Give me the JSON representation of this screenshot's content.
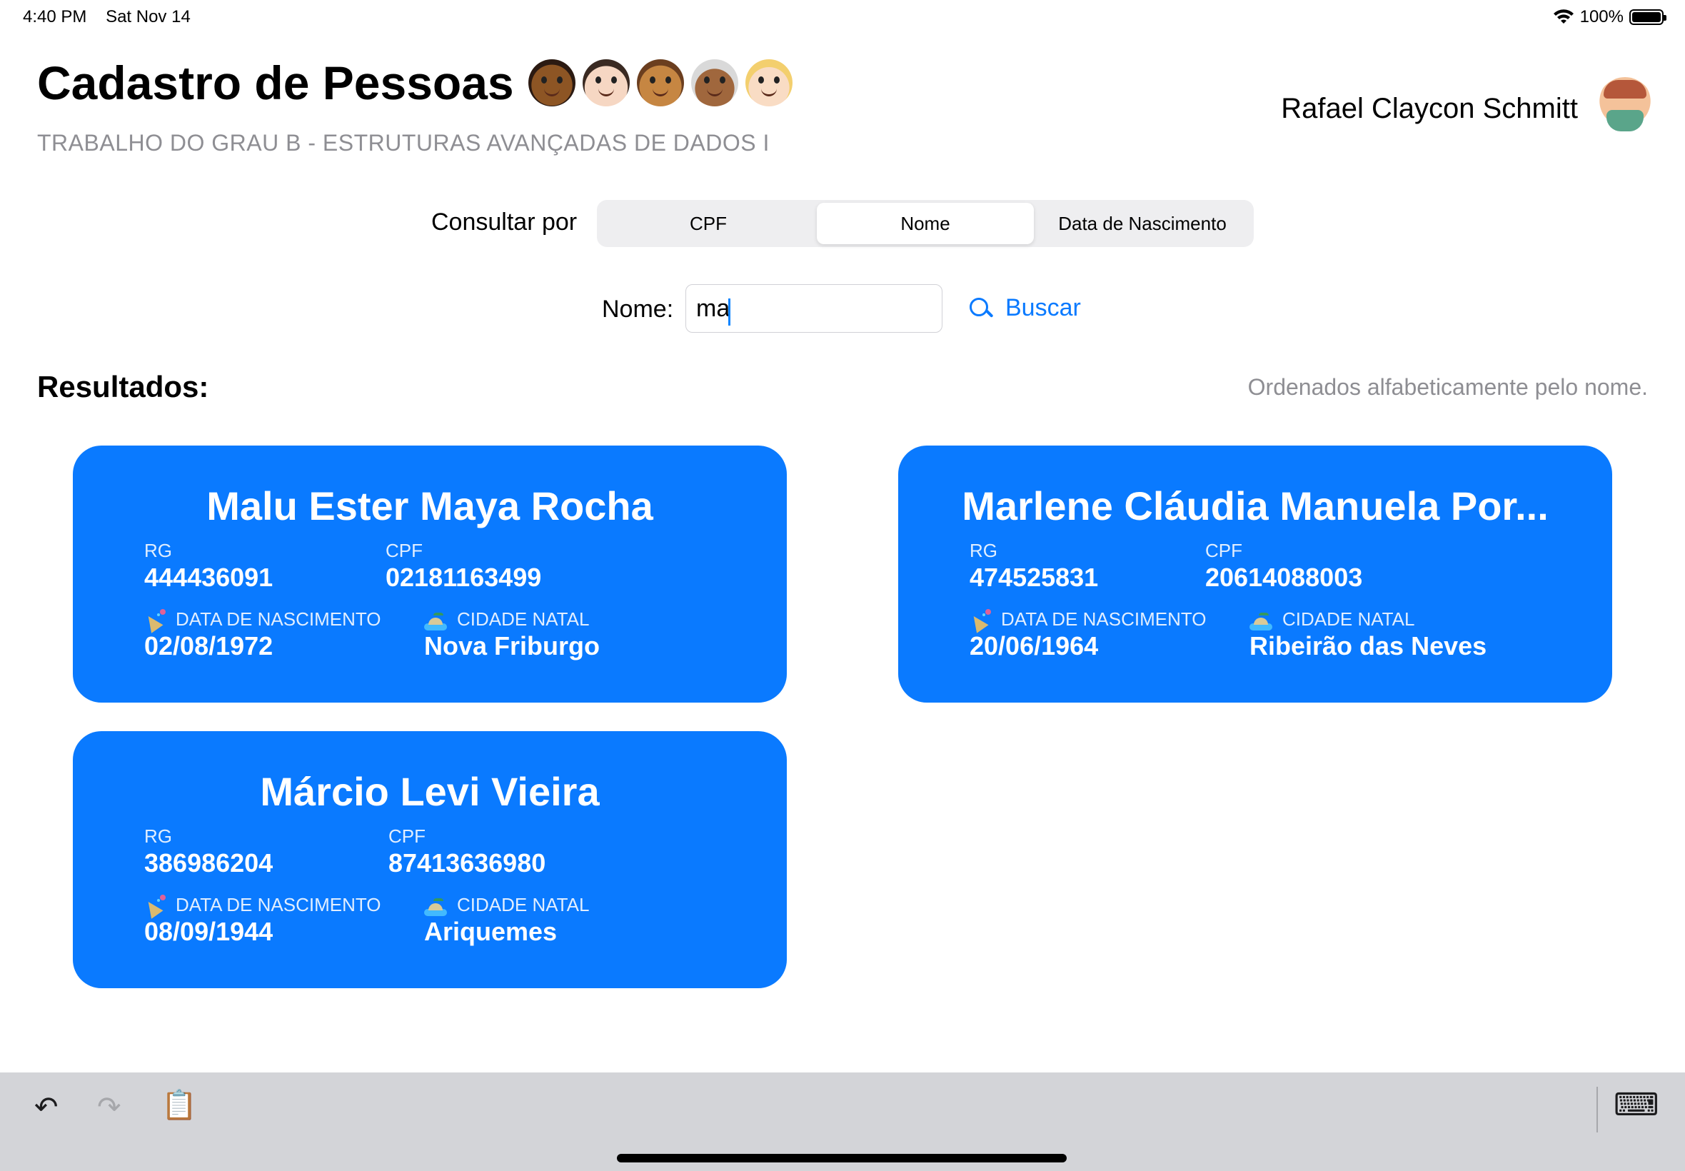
{
  "status_bar": {
    "time": "4:40 PM",
    "date": "Sat Nov 14",
    "battery": "100%",
    "battery_level": 1.0,
    "icons": [
      "wifi-icon",
      "battery-icon"
    ]
  },
  "header": {
    "title": "Cadastro de Pessoas",
    "emoji_faces": [
      "woman-dark-skin",
      "man-light-skin",
      "person-medium-skin",
      "old-woman-medium-dark-skin",
      "woman-blond-light-skin"
    ],
    "subtitle": "TRABALHO DO GRAU B - ESTRUTURAS AVANÇADAS DE DADOS I",
    "user_name": "Rafael Claycon Schmitt",
    "avatar_icon": "memoji-avatar-icon"
  },
  "query": {
    "label": "Consultar por",
    "options": [
      "CPF",
      "Nome",
      "Data de Nascimento"
    ],
    "selected": "Nome"
  },
  "search": {
    "field_label": "Nome:",
    "value": "ma",
    "button_label": "Buscar",
    "button_icon": "search-icon"
  },
  "results": {
    "title": "Resultados:",
    "note": "Ordenados alfabeticamente pelo nome.",
    "labels": {
      "rg": "RG",
      "cpf": "CPF",
      "birth": "DATA DE NASCIMENTO",
      "city": "CIDADE NATAL"
    },
    "items": [
      {
        "name": "Malu Ester Maya Rocha",
        "rg": "444436091",
        "cpf": "02181163499",
        "birth": "02/08/1972",
        "city": "Nova Friburgo"
      },
      {
        "name": "Marlene Cláudia Manuela Por...",
        "rg": "474525831",
        "cpf": "20614088003",
        "birth": "20/06/1964",
        "city": "Ribeirão das Neves"
      },
      {
        "name": "Márcio Levi Vieira",
        "rg": "386986204",
        "cpf": "87413636980",
        "birth": "08/09/1944",
        "city": "Ariquemes"
      }
    ]
  },
  "toolbar": {
    "undo": "↶",
    "redo": "↷",
    "paste": "📋",
    "keyboard": "⌨"
  },
  "colors": {
    "accent": "#0a7aff",
    "card": "#0a7aff",
    "secondary_text": "#8e8e93",
    "toolbar_bg": "#d3d4d8"
  }
}
